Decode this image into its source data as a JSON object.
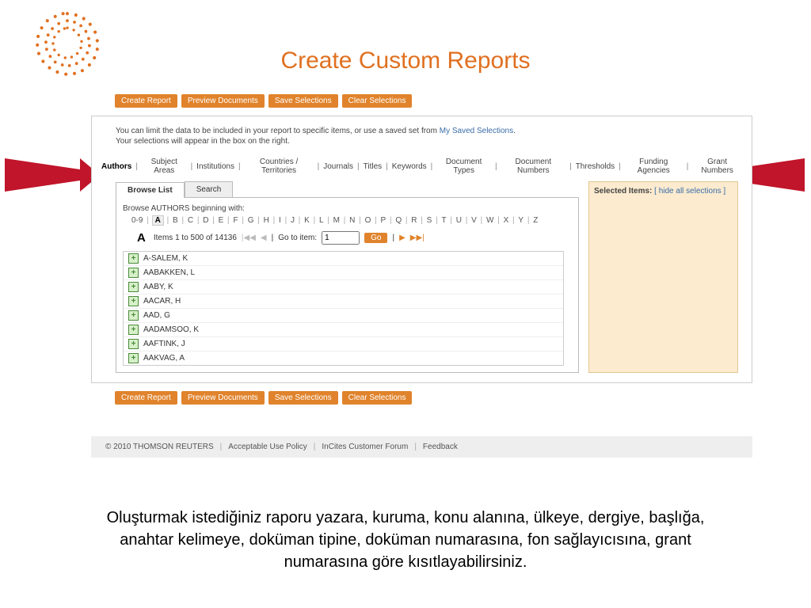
{
  "slide": {
    "title": "Create Custom Reports",
    "caption": "Oluşturmak istediğiniz raporu yazara, kuruma, konu alanına, ülkeye, dergiye, başlığa, anahtar kelimeye, doküman tipine, doküman numarasına, fon sağlayıcısına, grant numarasına göre kısıtlayabilirsiniz."
  },
  "buttons": {
    "create": "Create Report",
    "preview": "Preview Documents",
    "save": "Save Selections",
    "clear": "Clear Selections"
  },
  "intro": {
    "line1": "You can limit the data to be included in your report to specific items, or use a saved set from ",
    "link": "My Saved Selections",
    "line2": "Your selections will appear in the box on the right."
  },
  "filters": {
    "authors": "Authors",
    "subject": "Subject Areas",
    "institutions": "Institutions",
    "countries": "Countries / Territories",
    "journals": "Journals",
    "titles": "Titles",
    "keywords": "Keywords",
    "doctypes": "Document Types",
    "docnums": "Document Numbers",
    "thresholds": "Thresholds",
    "funding": "Funding Agencies",
    "grant": "Grant Numbers"
  },
  "tabs": {
    "browse": "Browse List",
    "search": "Search"
  },
  "browse": {
    "heading": "Browse AUTHORS beginning with:",
    "letters": [
      "0-9",
      "A",
      "B",
      "C",
      "D",
      "E",
      "F",
      "G",
      "H",
      "I",
      "J",
      "K",
      "L",
      "M",
      "N",
      "O",
      "P",
      "Q",
      "R",
      "S",
      "T",
      "U",
      "V",
      "W",
      "X",
      "Y",
      "Z"
    ],
    "selected_letter": "A",
    "items_label": "Items 1 to 500 of 14136",
    "goto_label": "Go to item:",
    "goto_value": "1",
    "go": "Go"
  },
  "authors": [
    "A-SALEM, K",
    "AABAKKEN, L",
    "AABY, K",
    "AACAR, H",
    "AAD, G",
    "AADAMSOO, K",
    "AAFTINK, J",
    "AAKVAG, A"
  ],
  "selected_panel": {
    "title": "Selected Items:",
    "hide": "[ hide all selections ]"
  },
  "footer": {
    "copyright": "© 2010 THOMSON REUTERS",
    "acceptable": "Acceptable Use Policy",
    "forum": "InCites Customer Forum",
    "feedback": "Feedback"
  }
}
